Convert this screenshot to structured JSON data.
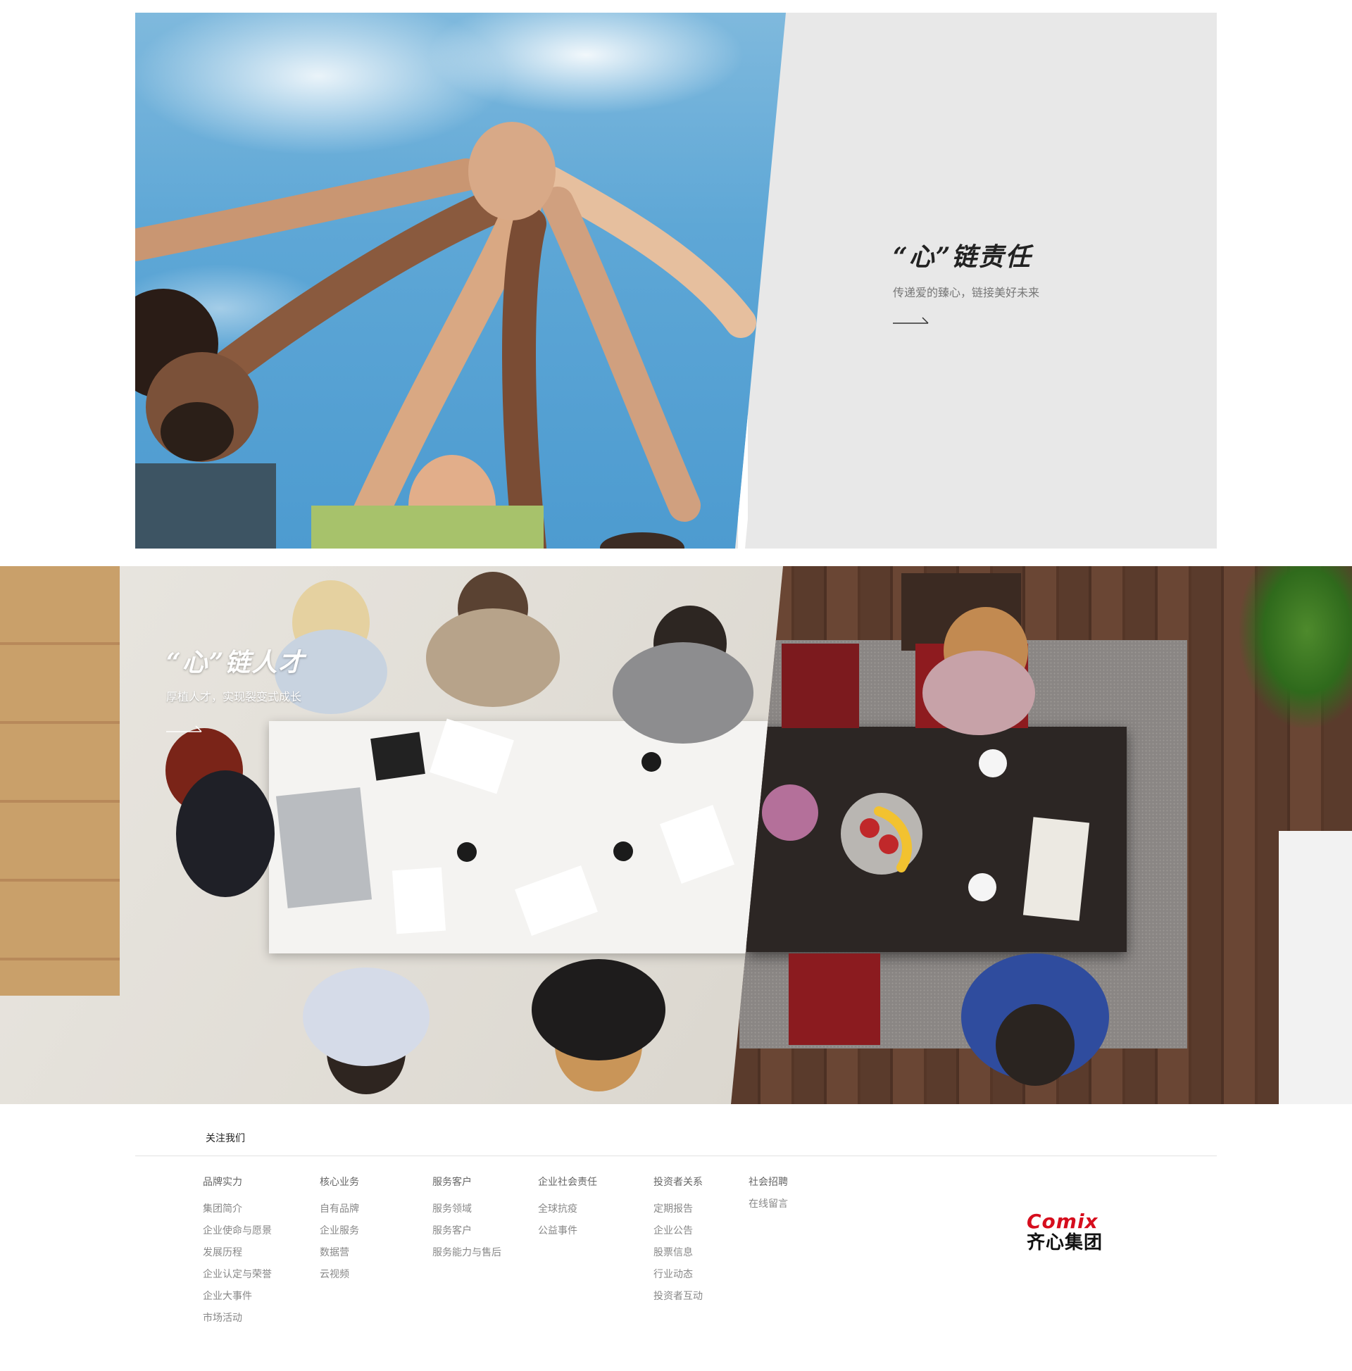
{
  "responsibility": {
    "title": "“心”链责任",
    "subtitle": "传递爱的臻心，链接美好未来"
  },
  "talent": {
    "title": "“心”链人才",
    "subtitle": "厚植人才，实现裂变式成长"
  },
  "footer": {
    "follow_label": "关注我们",
    "columns": [
      {
        "heading": "品牌实力",
        "items": [
          "集团简介",
          "企业使命与愿景",
          "发展历程",
          "企业认定与荣誉",
          "企业大事件",
          "市场活动"
        ]
      },
      {
        "heading": "核心业务",
        "items": [
          "自有品牌",
          "企业服务",
          "数据营",
          "云视频"
        ]
      },
      {
        "heading": "服务客户",
        "items": [
          "服务领域",
          "服务客户",
          "服务能力与售后"
        ]
      },
      {
        "heading": "企业社会责任",
        "items": [
          "全球抗疫",
          "公益事件"
        ]
      },
      {
        "heading": "投资者关系",
        "items": [
          "定期报告",
          "企业公告",
          "股票信息",
          "行业动态",
          "投资者互动"
        ]
      },
      {
        "heading": "社会招聘",
        "items": [
          "在线留言"
        ]
      }
    ],
    "logo": {
      "wordmark": "Comix",
      "name": "齐心集团",
      "brand_color": "#d60d1d"
    }
  },
  "icons": {
    "arrow": "arrow-right-icon"
  }
}
